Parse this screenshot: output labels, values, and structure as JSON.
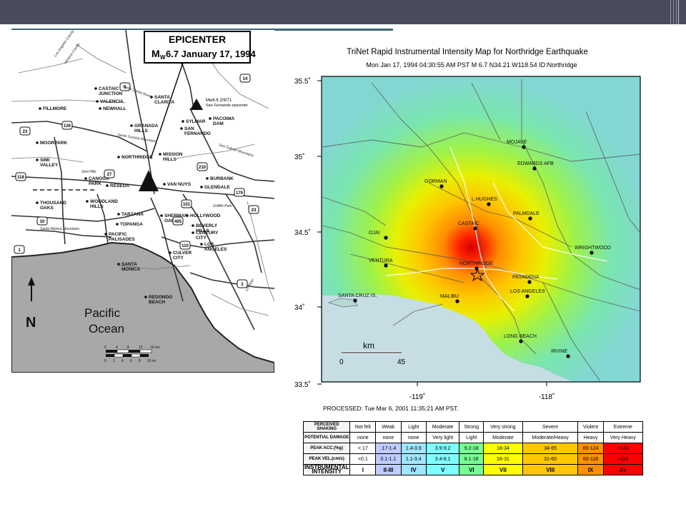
{
  "slide": {
    "left_map": {
      "epicenter_title_line1": "EPICENTER",
      "epicenter_title_line2": "M",
      "epicenter_title_sub": "W",
      "epicenter_title_rest": "6.7 January 17, 1994",
      "sf_epicenter_line1": "Mw6.6 2/9/71",
      "sf_epicenter_line2": "San Fernando epicenter",
      "places": [
        "FILLMORE",
        "CASTAIC JUNCTION",
        "VALENCIA",
        "NEWHALL",
        "SANTA CLARITA",
        "PACOIMA DAM",
        "SYLMAR",
        "GRANADA HILLS",
        "SAN FERNANDO",
        "MOORPARK",
        "SIMI VALLEY",
        "NORTHRIDGE",
        "MISSION HILLS",
        "CANOGA PARK",
        "RESEDA",
        "VAN NUYS",
        "BURBANK",
        "GLENDALE",
        "THOUSAND OAKS",
        "WOODLAND HILLS",
        "TARZANA",
        "SHERMAN OAKS",
        "HOLLYWOOD",
        "TOPANGA",
        "PACIFIC PALISADES",
        "BEVERLY HILLS",
        "CENTURY CITY",
        "SANTA MONICA",
        "CULVER CITY",
        "LOS ANGELES",
        "REDONDO BEACH"
      ],
      "roads": [
        "5",
        "14",
        "126",
        "23",
        "118",
        "27",
        "210",
        "405",
        "101",
        "170",
        "1",
        "10",
        "110",
        "2",
        "23"
      ],
      "features": [
        "Santa Clarita River",
        "Santa Susana Mountains",
        "San Gabriel Mountains",
        "Simi Hills",
        "Santa Monica Mountains",
        "Griffith Park",
        "LA River",
        "Los Angeles County",
        "Ventura County"
      ],
      "ocean_line1": "Pacific",
      "ocean_line2": "Ocean",
      "north": "N",
      "scale_km": [
        "0",
        "4",
        "8",
        "12",
        "16 km"
      ],
      "scale_mi": [
        "0",
        "2",
        "4",
        "6",
        "8",
        "10 mi"
      ]
    },
    "right_map": {
      "title": "TriNet Rapid Instrumental Intensity Map for Northridge Earthquake",
      "subtitle": "Mon Jan 17, 1994 04:30:55 AM PST   M 6.7   N34.21 W118.54   ID:Northridge",
      "lat_ticks": [
        "35.5˚",
        "35˚",
        "34.5˚",
        "34˚",
        "33.5˚"
      ],
      "lon_ticks": [
        "-119˚",
        "-118˚"
      ],
      "cities": [
        "MOJAVE",
        "EDWARDS AFB",
        "GORMAN",
        "L.HUGHES",
        "PALMDALE",
        "CASTAIC",
        "OJAI",
        "WRIGHTWOOD",
        "VENTURA",
        "NORTHRIDGE",
        "PASADENA",
        "SANTA CRUZ IS.",
        "MALIBU",
        "LOS ANGELES",
        "LONG BEACH",
        "IRVINE"
      ],
      "scale_unit": "km",
      "scale_ticks": [
        "0",
        "45"
      ],
      "processed": "PROCESSED: Tue Mar 6, 2001 11:35:21 AM PST."
    },
    "legend": {
      "rows": [
        {
          "label": "PERCEIVED SHAKING",
          "cells": [
            "Not felt",
            "Weak",
            "Light",
            "Moderate",
            "Strong",
            "Very strong",
            "Severe",
            "Violent",
            "Extreme"
          ]
        },
        {
          "label": "POTENTIAL DAMAGE",
          "cells": [
            "none",
            "none",
            "none",
            "Very light",
            "Light",
            "Moderate",
            "Moderate/Heavy",
            "Heavy",
            "Very Heavy"
          ]
        },
        {
          "label": "PEAK ACC.(%g)",
          "cells": [
            "<.17",
            ".17-1.4",
            "1.4-3.9",
            "3.9-9.2",
            "9.2-18",
            "18-34",
            "34-65",
            "65-124",
            ">124"
          ]
        },
        {
          "label": "PEAK VEL.(cm/s)",
          "cells": [
            "<0.1",
            "0.1-1.1",
            "1.1-3.4",
            "3.4-8.1",
            "8.1-16",
            "16-31",
            "31-60",
            "60-116",
            ">116"
          ]
        },
        {
          "label": "INSTRUMENTAL INTENSITY",
          "cells": [
            "I",
            "II-III",
            "IV",
            "V",
            "VI",
            "VII",
            "VIII",
            "IX",
            "X+"
          ]
        }
      ],
      "intensity_colors": [
        "#ffffff",
        "#bfccff",
        "#a0e6ff",
        "#80ffff",
        "#7aff93",
        "#ffff00",
        "#ffc800",
        "#ff9100",
        "#ff0000"
      ]
    }
  }
}
